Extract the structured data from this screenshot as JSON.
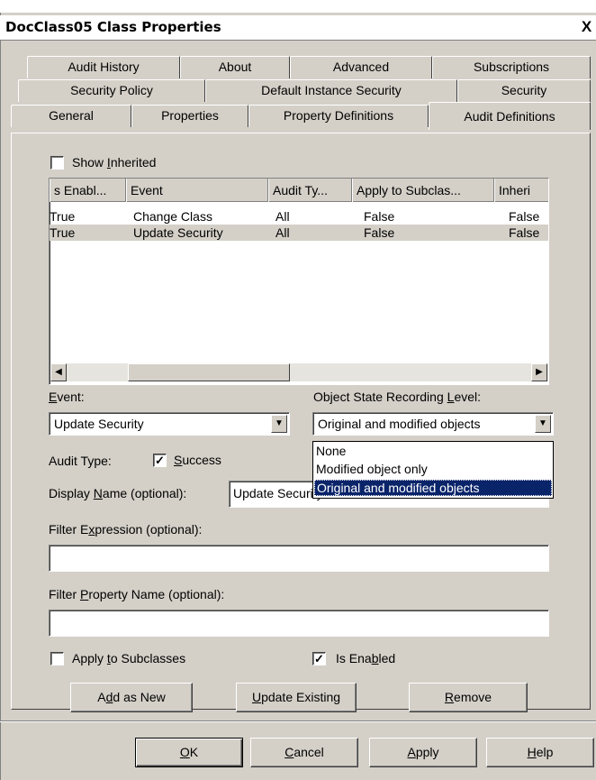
{
  "window": {
    "title": "DocClass05 Class Properties",
    "close_glyph": "X"
  },
  "tabs": {
    "row1": [
      "Audit History",
      "About",
      "Advanced",
      "Subscriptions"
    ],
    "row2": [
      "Security Policy",
      "Default Instance Security",
      "Security"
    ],
    "row3": [
      "General",
      "Properties",
      "Property Definitions",
      "Audit Definitions"
    ],
    "active": "Audit Definitions"
  },
  "show_inherited": {
    "label": "Show Inherited",
    "mnemonic": "I",
    "checked": false
  },
  "list": {
    "columns": [
      "s Enabl...",
      "Event",
      "Audit Ty...",
      "Apply to Subclas...",
      "Inheri"
    ],
    "rows": [
      [
        "True",
        "Change Class",
        "All",
        "False",
        "False"
      ],
      [
        "True",
        "Update Security",
        "All",
        "False",
        "False"
      ]
    ],
    "selected_row": 1
  },
  "event": {
    "label": "Event:",
    "mnemonic": "E",
    "value": "Update Security"
  },
  "object_state": {
    "label": "Object State Recording Level:",
    "mnemonic": "L",
    "value": "Original and modified objects",
    "options": [
      "None",
      "Modified object only",
      "Original and modified objects"
    ],
    "selected_option": 2
  },
  "audit_type": {
    "label": "Audit Type:",
    "success_label": "Success",
    "success_mnemonic": "S",
    "success_checked": true
  },
  "display_name": {
    "label": "Display Name (optional):",
    "mnemonic": "N",
    "value": "Update Security"
  },
  "filter_expression": {
    "label": "Filter Expression (optional):",
    "mnemonic": "x",
    "value": ""
  },
  "filter_property": {
    "label": "Filter Property Name (optional):",
    "mnemonic": "P",
    "value": ""
  },
  "apply_subclasses": {
    "label": "Apply to Subclasses",
    "mnemonic": "t",
    "checked": false
  },
  "is_enabled": {
    "label": "Is Enabled",
    "mnemonic": "b",
    "checked": true
  },
  "action_buttons": {
    "add_new": "Add as New",
    "update_existing": "Update Existing",
    "remove": "Remove"
  },
  "dialog_buttons": {
    "ok": "OK",
    "cancel": "Cancel",
    "apply": "Apply",
    "help": "Help"
  },
  "colors": {
    "face": "#d4d0c8",
    "selection": "#0a246a"
  }
}
